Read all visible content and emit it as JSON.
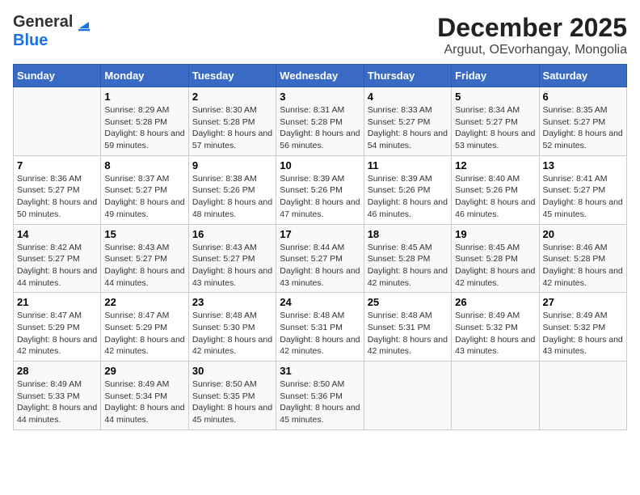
{
  "header": {
    "logo_general": "General",
    "logo_blue": "Blue",
    "title": "December 2025",
    "subtitle": "Arguut, OEvorhangay, Mongolia"
  },
  "weekdays": [
    "Sunday",
    "Monday",
    "Tuesday",
    "Wednesday",
    "Thursday",
    "Friday",
    "Saturday"
  ],
  "weeks": [
    [
      {
        "day": "",
        "sunrise": "",
        "sunset": "",
        "daylight": ""
      },
      {
        "day": "1",
        "sunrise": "Sunrise: 8:29 AM",
        "sunset": "Sunset: 5:28 PM",
        "daylight": "Daylight: 8 hours and 59 minutes."
      },
      {
        "day": "2",
        "sunrise": "Sunrise: 8:30 AM",
        "sunset": "Sunset: 5:28 PM",
        "daylight": "Daylight: 8 hours and 57 minutes."
      },
      {
        "day": "3",
        "sunrise": "Sunrise: 8:31 AM",
        "sunset": "Sunset: 5:28 PM",
        "daylight": "Daylight: 8 hours and 56 minutes."
      },
      {
        "day": "4",
        "sunrise": "Sunrise: 8:33 AM",
        "sunset": "Sunset: 5:27 PM",
        "daylight": "Daylight: 8 hours and 54 minutes."
      },
      {
        "day": "5",
        "sunrise": "Sunrise: 8:34 AM",
        "sunset": "Sunset: 5:27 PM",
        "daylight": "Daylight: 8 hours and 53 minutes."
      },
      {
        "day": "6",
        "sunrise": "Sunrise: 8:35 AM",
        "sunset": "Sunset: 5:27 PM",
        "daylight": "Daylight: 8 hours and 52 minutes."
      }
    ],
    [
      {
        "day": "7",
        "sunrise": "Sunrise: 8:36 AM",
        "sunset": "Sunset: 5:27 PM",
        "daylight": "Daylight: 8 hours and 50 minutes."
      },
      {
        "day": "8",
        "sunrise": "Sunrise: 8:37 AM",
        "sunset": "Sunset: 5:27 PM",
        "daylight": "Daylight: 8 hours and 49 minutes."
      },
      {
        "day": "9",
        "sunrise": "Sunrise: 8:38 AM",
        "sunset": "Sunset: 5:26 PM",
        "daylight": "Daylight: 8 hours and 48 minutes."
      },
      {
        "day": "10",
        "sunrise": "Sunrise: 8:39 AM",
        "sunset": "Sunset: 5:26 PM",
        "daylight": "Daylight: 8 hours and 47 minutes."
      },
      {
        "day": "11",
        "sunrise": "Sunrise: 8:39 AM",
        "sunset": "Sunset: 5:26 PM",
        "daylight": "Daylight: 8 hours and 46 minutes."
      },
      {
        "day": "12",
        "sunrise": "Sunrise: 8:40 AM",
        "sunset": "Sunset: 5:26 PM",
        "daylight": "Daylight: 8 hours and 46 minutes."
      },
      {
        "day": "13",
        "sunrise": "Sunrise: 8:41 AM",
        "sunset": "Sunset: 5:27 PM",
        "daylight": "Daylight: 8 hours and 45 minutes."
      }
    ],
    [
      {
        "day": "14",
        "sunrise": "Sunrise: 8:42 AM",
        "sunset": "Sunset: 5:27 PM",
        "daylight": "Daylight: 8 hours and 44 minutes."
      },
      {
        "day": "15",
        "sunrise": "Sunrise: 8:43 AM",
        "sunset": "Sunset: 5:27 PM",
        "daylight": "Daylight: 8 hours and 44 minutes."
      },
      {
        "day": "16",
        "sunrise": "Sunrise: 8:43 AM",
        "sunset": "Sunset: 5:27 PM",
        "daylight": "Daylight: 8 hours and 43 minutes."
      },
      {
        "day": "17",
        "sunrise": "Sunrise: 8:44 AM",
        "sunset": "Sunset: 5:27 PM",
        "daylight": "Daylight: 8 hours and 43 minutes."
      },
      {
        "day": "18",
        "sunrise": "Sunrise: 8:45 AM",
        "sunset": "Sunset: 5:28 PM",
        "daylight": "Daylight: 8 hours and 42 minutes."
      },
      {
        "day": "19",
        "sunrise": "Sunrise: 8:45 AM",
        "sunset": "Sunset: 5:28 PM",
        "daylight": "Daylight: 8 hours and 42 minutes."
      },
      {
        "day": "20",
        "sunrise": "Sunrise: 8:46 AM",
        "sunset": "Sunset: 5:28 PM",
        "daylight": "Daylight: 8 hours and 42 minutes."
      }
    ],
    [
      {
        "day": "21",
        "sunrise": "Sunrise: 8:47 AM",
        "sunset": "Sunset: 5:29 PM",
        "daylight": "Daylight: 8 hours and 42 minutes."
      },
      {
        "day": "22",
        "sunrise": "Sunrise: 8:47 AM",
        "sunset": "Sunset: 5:29 PM",
        "daylight": "Daylight: 8 hours and 42 minutes."
      },
      {
        "day": "23",
        "sunrise": "Sunrise: 8:48 AM",
        "sunset": "Sunset: 5:30 PM",
        "daylight": "Daylight: 8 hours and 42 minutes."
      },
      {
        "day": "24",
        "sunrise": "Sunrise: 8:48 AM",
        "sunset": "Sunset: 5:31 PM",
        "daylight": "Daylight: 8 hours and 42 minutes."
      },
      {
        "day": "25",
        "sunrise": "Sunrise: 8:48 AM",
        "sunset": "Sunset: 5:31 PM",
        "daylight": "Daylight: 8 hours and 42 minutes."
      },
      {
        "day": "26",
        "sunrise": "Sunrise: 8:49 AM",
        "sunset": "Sunset: 5:32 PM",
        "daylight": "Daylight: 8 hours and 43 minutes."
      },
      {
        "day": "27",
        "sunrise": "Sunrise: 8:49 AM",
        "sunset": "Sunset: 5:32 PM",
        "daylight": "Daylight: 8 hours and 43 minutes."
      }
    ],
    [
      {
        "day": "28",
        "sunrise": "Sunrise: 8:49 AM",
        "sunset": "Sunset: 5:33 PM",
        "daylight": "Daylight: 8 hours and 44 minutes."
      },
      {
        "day": "29",
        "sunrise": "Sunrise: 8:49 AM",
        "sunset": "Sunset: 5:34 PM",
        "daylight": "Daylight: 8 hours and 44 minutes."
      },
      {
        "day": "30",
        "sunrise": "Sunrise: 8:50 AM",
        "sunset": "Sunset: 5:35 PM",
        "daylight": "Daylight: 8 hours and 45 minutes."
      },
      {
        "day": "31",
        "sunrise": "Sunrise: 8:50 AM",
        "sunset": "Sunset: 5:36 PM",
        "daylight": "Daylight: 8 hours and 45 minutes."
      },
      {
        "day": "",
        "sunrise": "",
        "sunset": "",
        "daylight": ""
      },
      {
        "day": "",
        "sunrise": "",
        "sunset": "",
        "daylight": ""
      },
      {
        "day": "",
        "sunrise": "",
        "sunset": "",
        "daylight": ""
      }
    ]
  ]
}
